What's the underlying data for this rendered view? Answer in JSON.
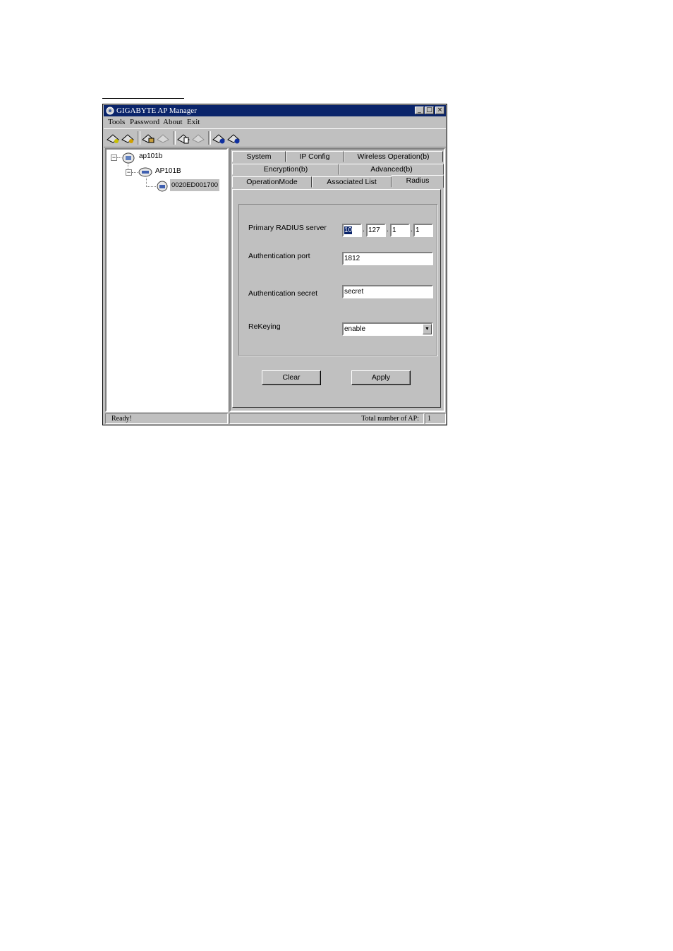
{
  "window": {
    "title": "GIGABYTE AP Manager",
    "minimize": "_",
    "maximize": "□",
    "close": "×"
  },
  "menu": [
    "Tools",
    "Password",
    "About",
    "Exit"
  ],
  "tree": {
    "root": "ap101b",
    "child": "AP101B",
    "leaf": "0020ED001700",
    "collapse_glyph": "−"
  },
  "tabs": {
    "row1": [
      "System",
      "IP Config",
      "Wireless Operation(b)"
    ],
    "row2": [
      "Encryption(b)",
      "Advanced(b)"
    ],
    "row3": [
      "OperationMode",
      "Associated List",
      "Radius"
    ],
    "active": "Radius"
  },
  "radius": {
    "primary_label": "Primary RADIUS server",
    "ip": [
      "10",
      "127",
      "1",
      "1"
    ],
    "ip_sep": ".",
    "port_label": "Authentication port",
    "port_value": "1812",
    "secret_label": "Authentication secret",
    "secret_value": "secret",
    "rekey_label": "ReKeying",
    "rekey_value": "enable",
    "dropdown_arrow": "▼"
  },
  "buttons": {
    "clear": "Clear",
    "apply": "Apply"
  },
  "status": {
    "ready": "Ready!",
    "total_label": "Total number of AP:",
    "total_value": "1"
  }
}
